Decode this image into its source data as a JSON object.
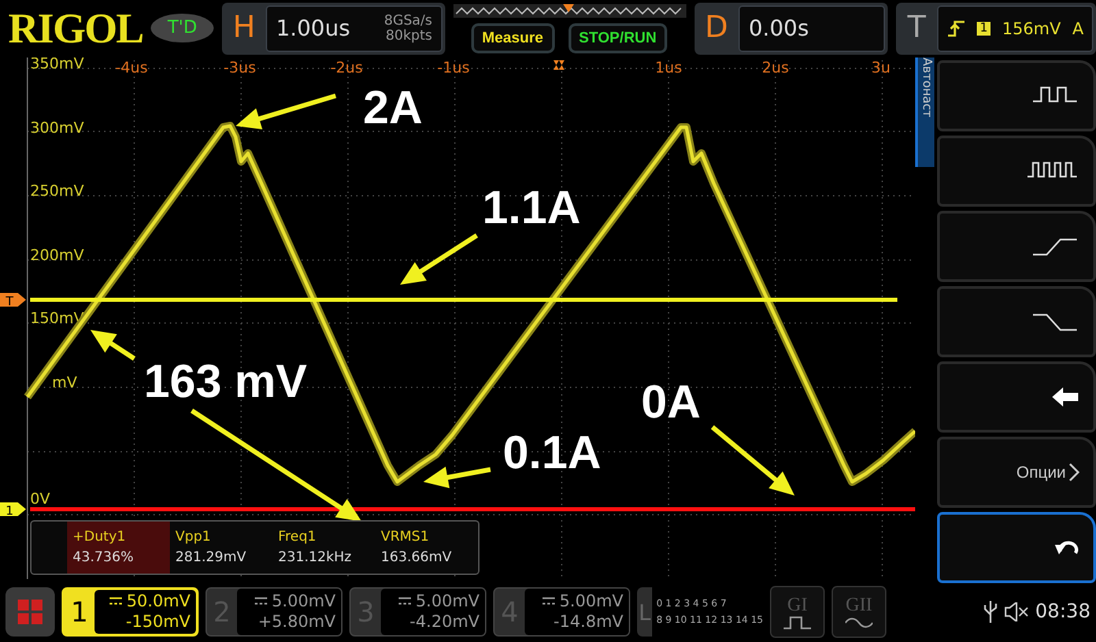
{
  "logo": "RIGOL",
  "trigger_status": "T'D",
  "horizontal": {
    "label": "H",
    "timebase": "1.00us",
    "sample_rate": "8GSa/s",
    "memory_depth": "80kpts"
  },
  "buttons": [
    {
      "label": "Measure",
      "kind": "measure"
    },
    {
      "label": "STOP/RUN",
      "kind": "run"
    }
  ],
  "delay": {
    "label": "D",
    "value": "0.00s"
  },
  "trigger": {
    "label": "T",
    "source": "1",
    "level": "156mV",
    "mode": "A"
  },
  "plot": {
    "y_labels": [
      "350mV",
      "300mV",
      "250mV",
      "200mV",
      "150mV",
      "mV",
      "0V"
    ],
    "x_labels": [
      "-4us",
      "-3us",
      "-2us",
      "-1us",
      "1us",
      "2us",
      "3u"
    ],
    "trigger_marker": "T",
    "channel_marker": "1",
    "annotations": [
      {
        "text": "2A"
      },
      {
        "text": "1.1A"
      },
      {
        "text": "163 mV"
      },
      {
        "text": "0.1A"
      },
      {
        "text": "0A"
      }
    ]
  },
  "measurements": [
    {
      "name": "+Duty1",
      "value": "43.736%",
      "selected": true
    },
    {
      "name": "Vpp1",
      "value": "281.29mV",
      "selected": false
    },
    {
      "name": "Freq1",
      "value": "231.12kHz",
      "selected": false
    },
    {
      "name": "VRMS1",
      "value": "163.66mV",
      "selected": false
    }
  ],
  "side_menu": {
    "tab": "Автонаст",
    "items": [
      {
        "kind": "pulse"
      },
      {
        "kind": "pulses"
      },
      {
        "kind": "rise"
      },
      {
        "kind": "fall"
      },
      {
        "kind": "back"
      },
      {
        "kind": "options",
        "label": "Опции"
      }
    ]
  },
  "undo": {
    "kind": "undo"
  },
  "channels": [
    {
      "number": "1",
      "scale": "50.0mV",
      "offset": "-150mV",
      "selected": true
    },
    {
      "number": "2",
      "scale": "5.00mV",
      "offset": "+5.80mV",
      "selected": false
    },
    {
      "number": "3",
      "scale": "5.00mV",
      "offset": "-4.20mV",
      "selected": false
    },
    {
      "number": "4",
      "scale": "5.00mV",
      "offset": "-14.8mV",
      "selected": false
    }
  ],
  "logic": {
    "label": "L",
    "row_1": "0 1 2 3  4 5 6 7",
    "row_2": "8 9 10 11 12 13 14 15"
  },
  "generators": [
    {
      "label": "GI",
      "kind": "pulse"
    },
    {
      "label": "GII",
      "kind": "sine"
    }
  ],
  "status": {
    "time": "08:38"
  }
}
